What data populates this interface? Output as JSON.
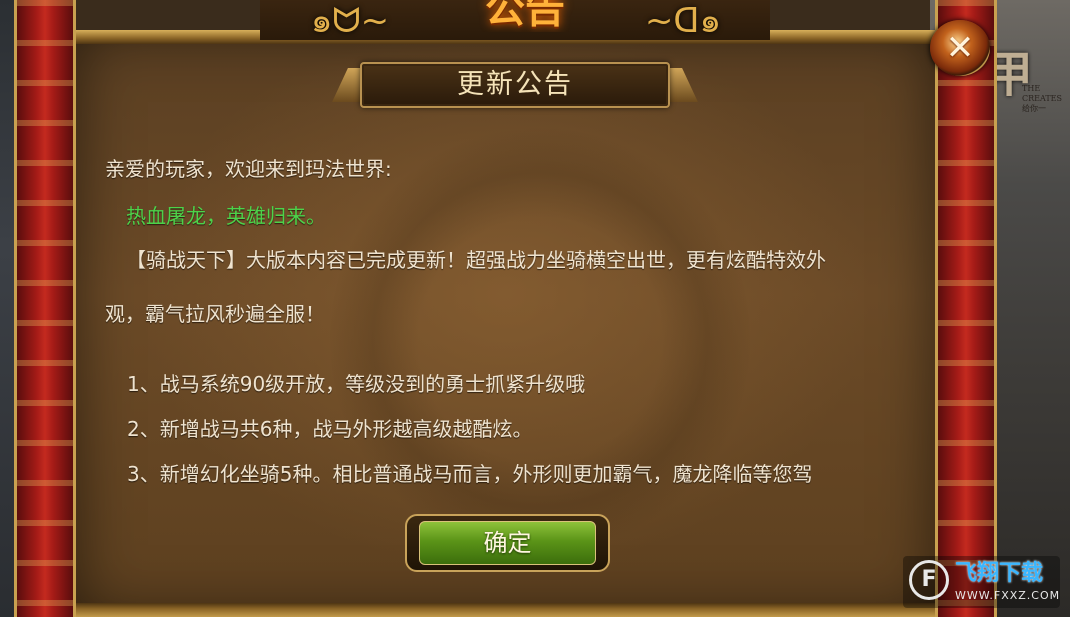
{
  "window": {
    "banner_title": "公告",
    "background_logo_text": "甲传",
    "background_logo_sub_en": "THE CREATES",
    "background_logo_sub_cn": "给你一"
  },
  "dialog": {
    "title": "更新公告",
    "close_label": "✕",
    "greeting": "亲爱的玩家，欢迎来到玛法世界:",
    "slogan": "热血屠龙，英雄归来。",
    "paragraph_line1": "【骑战天下】大版本内容已完成更新！超强战力坐骑横空出世，更有炫酷特效外",
    "paragraph_line2": "观，霸气拉风秒遍全服！",
    "items": [
      "1、战马系统90级开放，等级没到的勇士抓紧升级哦",
      "2、新增战马共6种，战马外形越高级越酷炫。",
      "3、新增幻化坐骑5种。相比普通战马而言，外形则更加霸气，魔龙降临等您驾"
    ],
    "confirm_label": "确定"
  },
  "watermark": {
    "logo_glyph": "F",
    "name": "飞翔下载",
    "url": "WWW.FXXZ.COM"
  },
  "colors": {
    "slogan": "#4dd24a",
    "body_text": "#efe3cf",
    "title_text": "#f5e3b8",
    "banner_text": "#ffb23a",
    "confirm_green": "#5b9418",
    "pillar_red": "#a41b17"
  },
  "icons": {
    "close": "close-icon",
    "dragon_left": "dragon-ornament-icon",
    "dragon_right": "dragon-ornament-icon",
    "watermark_logo": "fxxz-logo-icon"
  }
}
